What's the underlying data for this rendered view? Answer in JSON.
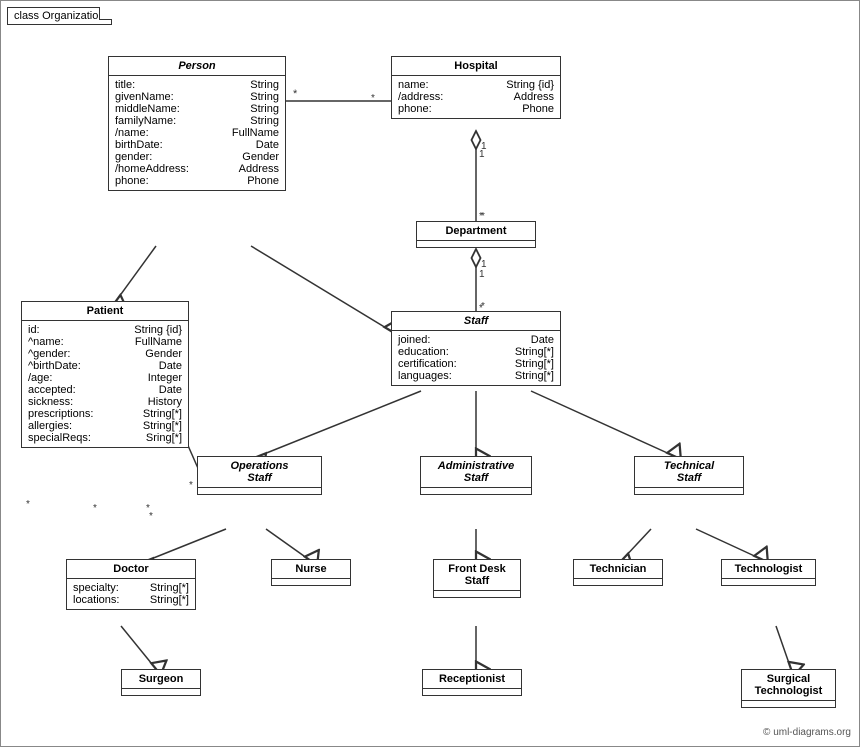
{
  "diagram": {
    "title": "class Organization",
    "copyright": "© uml-diagrams.org",
    "classes": {
      "person": {
        "name": "Person",
        "italic": true,
        "attrs": [
          {
            "name": "title:",
            "type": "String"
          },
          {
            "name": "givenName:",
            "type": "String"
          },
          {
            "name": "middleName:",
            "type": "String"
          },
          {
            "name": "familyName:",
            "type": "String"
          },
          {
            "name": "/name:",
            "type": "FullName"
          },
          {
            "name": "birthDate:",
            "type": "Date"
          },
          {
            "name": "gender:",
            "type": "Gender"
          },
          {
            "name": "/homeAddress:",
            "type": "Address"
          },
          {
            "name": "phone:",
            "type": "Phone"
          }
        ]
      },
      "hospital": {
        "name": "Hospital",
        "italic": false,
        "attrs": [
          {
            "name": "name:",
            "type": "String {id}"
          },
          {
            "name": "/address:",
            "type": "Address"
          },
          {
            "name": "phone:",
            "type": "Phone"
          }
        ]
      },
      "patient": {
        "name": "Patient",
        "italic": false,
        "attrs": [
          {
            "name": "id:",
            "type": "String {id}"
          },
          {
            "name": "^name:",
            "type": "FullName"
          },
          {
            "name": "^gender:",
            "type": "Gender"
          },
          {
            "name": "^birthDate:",
            "type": "Date"
          },
          {
            "name": "/age:",
            "type": "Integer"
          },
          {
            "name": "accepted:",
            "type": "Date"
          },
          {
            "name": "sickness:",
            "type": "History"
          },
          {
            "name": "prescriptions:",
            "type": "String[*]"
          },
          {
            "name": "allergies:",
            "type": "String[*]"
          },
          {
            "name": "specialReqs:",
            "type": "Sring[*]"
          }
        ]
      },
      "department": {
        "name": "Department",
        "italic": false,
        "attrs": []
      },
      "staff": {
        "name": "Staff",
        "italic": true,
        "attrs": [
          {
            "name": "joined:",
            "type": "Date"
          },
          {
            "name": "education:",
            "type": "String[*]"
          },
          {
            "name": "certification:",
            "type": "String[*]"
          },
          {
            "name": "languages:",
            "type": "String[*]"
          }
        ]
      },
      "operations_staff": {
        "name": "Operations\nStaff",
        "italic": true,
        "attrs": []
      },
      "administrative_staff": {
        "name": "Administrative\nStaff",
        "italic": true,
        "attrs": []
      },
      "technical_staff": {
        "name": "Technical\nStaff",
        "italic": true,
        "attrs": []
      },
      "doctor": {
        "name": "Doctor",
        "italic": false,
        "attrs": [
          {
            "name": "specialty:",
            "type": "String[*]"
          },
          {
            "name": "locations:",
            "type": "String[*]"
          }
        ]
      },
      "nurse": {
        "name": "Nurse",
        "italic": false,
        "attrs": []
      },
      "front_desk_staff": {
        "name": "Front Desk\nStaff",
        "italic": false,
        "attrs": []
      },
      "technician": {
        "name": "Technician",
        "italic": false,
        "attrs": []
      },
      "technologist": {
        "name": "Technologist",
        "italic": false,
        "attrs": []
      },
      "surgeon": {
        "name": "Surgeon",
        "italic": false,
        "attrs": []
      },
      "receptionist": {
        "name": "Receptionist",
        "italic": false,
        "attrs": []
      },
      "surgical_technologist": {
        "name": "Surgical\nTechnologist",
        "italic": false,
        "attrs": []
      }
    }
  }
}
